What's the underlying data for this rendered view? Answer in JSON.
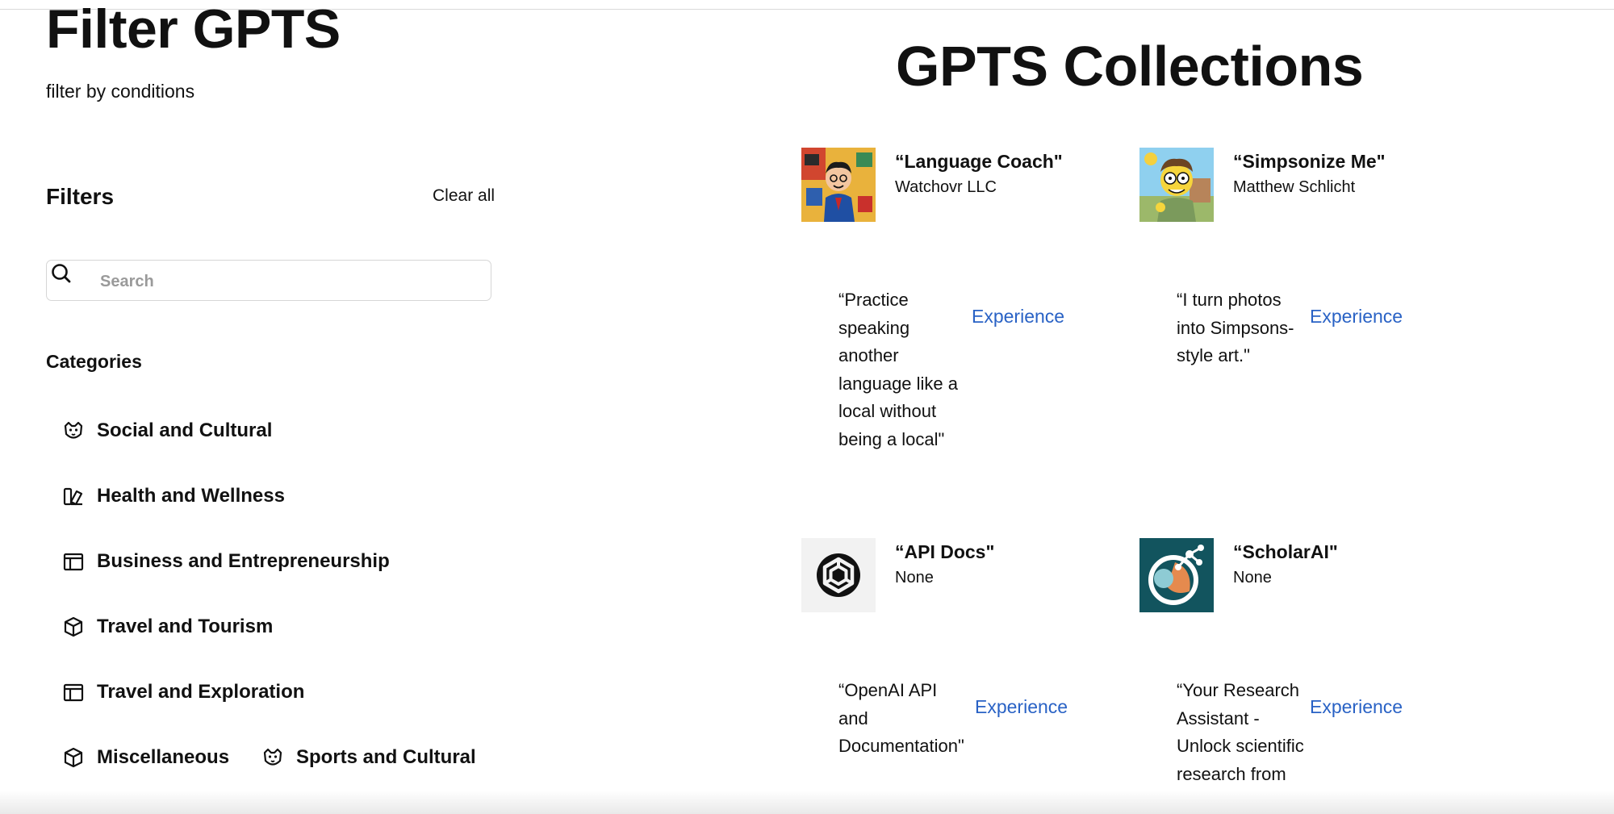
{
  "left": {
    "title": "Filter GPTS",
    "subtitle": "filter by conditions",
    "filters_heading": "Filters",
    "clear_all": "Clear all",
    "search": {
      "placeholder": "Search",
      "value": "",
      "icon": "search-icon"
    },
    "categories_heading": "Categories",
    "categories": [
      {
        "label": "Social and Cultural",
        "icon": "dog-face-icon"
      },
      {
        "label": "Health and Wellness",
        "icon": "swatch-book-icon"
      },
      {
        "label": "Business and Entrepreneurship",
        "icon": "layout-panel-icon"
      },
      {
        "label": "Travel and Tourism",
        "icon": "cube-icon"
      },
      {
        "label": "Travel and Exploration",
        "icon": "layout-panel-icon"
      },
      {
        "label": "Miscellaneous",
        "icon": "cube-icon"
      },
      {
        "label": "Sports and Cultural",
        "icon": "dog-face-icon"
      }
    ]
  },
  "collections": {
    "title": "GPTS Collections",
    "link_color": "#2962c5",
    "cards": [
      {
        "name": "“Language Coach\"",
        "author": "Watchovr LLC",
        "description": "“Practice speaking another language like a local without being a local\"",
        "action": "Experience",
        "thumbnail": "cartoon-businessman-avatar"
      },
      {
        "name": "“Simpsonize Me\"",
        "author": "Matthew Schlicht",
        "description": "“I turn photos into Simpsons-style art.\"",
        "action": "Experience",
        "thumbnail": "yellow-cartoon-character-avatar"
      },
      {
        "name": "“API Docs\"",
        "author": "None",
        "description": "“OpenAI API and Documentation\"",
        "action": "Experience",
        "thumbnail": "openai-logo"
      },
      {
        "name": "“ScholarAI\"",
        "author": "None",
        "description": "“Your Research Assistant - Unlock scientific research from",
        "action": "Experience",
        "thumbnail": "scholarai-logo"
      }
    ]
  }
}
